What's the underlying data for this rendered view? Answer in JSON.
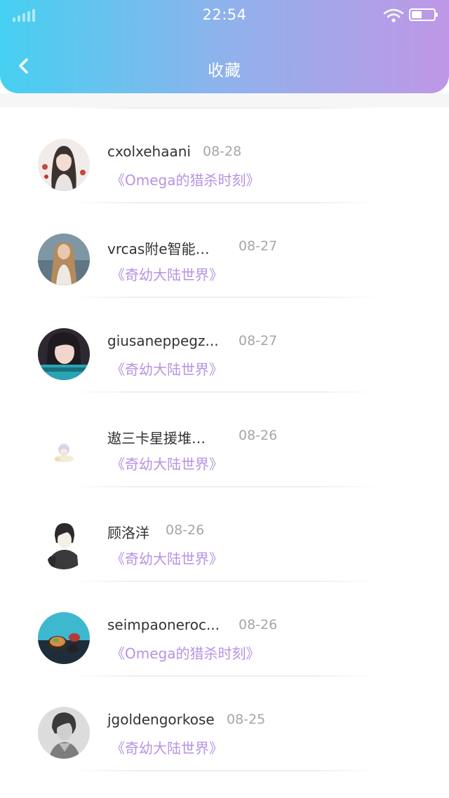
{
  "status_bar": {
    "time": "22:54",
    "signal_icon": "signal-icon",
    "wifi_icon": "wifi-icon",
    "battery_icon": "battery-icon",
    "battery_level": 0.45
  },
  "header": {
    "back_icon": "chevron-left-icon",
    "title": "收藏"
  },
  "colors": {
    "gradient_start": "#45d0f1",
    "gradient_end": "#bf97e6",
    "book_title": "#b792e4",
    "username": "#333333",
    "date": "#a6a6a6"
  },
  "favorites": [
    {
      "username": "cxolxehaani",
      "date": "08-28",
      "book": "《Omega的猎杀时刻》"
    },
    {
      "username": "vrcas附e智能…",
      "date": "08-27",
      "book": "《奇幼大陆世界》"
    },
    {
      "username": "giusaneppegz...",
      "date": "08-27",
      "book": "《奇幼大陆世界》"
    },
    {
      "username": "遨三卡星援堆…",
      "date": "08-26",
      "book": "《奇幼大陆世界》"
    },
    {
      "username": "顾洛洋",
      "date": "08-26",
      "book": "《奇幼大陆世界》"
    },
    {
      "username": "seimpaoneroc...",
      "date": "08-26",
      "book": "《Omega的猎杀时刻》"
    },
    {
      "username": "jgoldengorkose",
      "date": "08-25",
      "book": "《奇幼大陆世界》"
    }
  ]
}
